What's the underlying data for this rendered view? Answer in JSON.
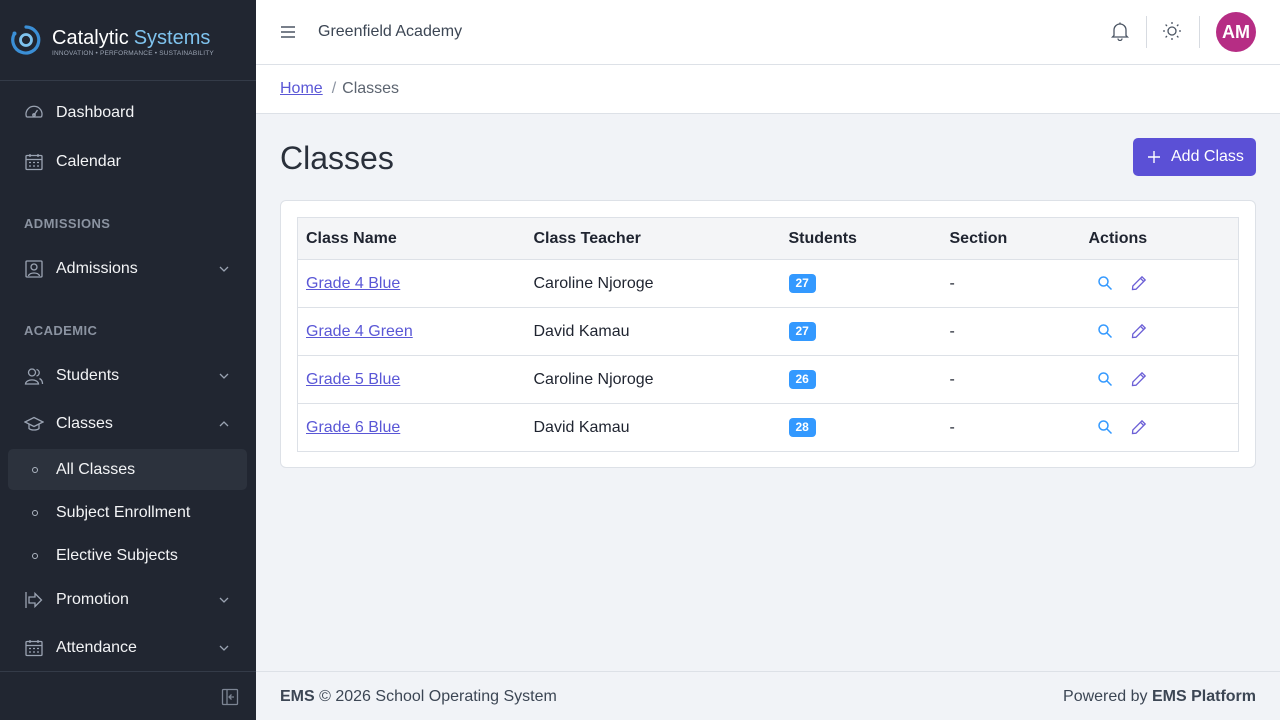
{
  "brand": {
    "name_primary": "Catalytic",
    "name_secondary": "Systems",
    "tagline": "INNOVATION • PERFORMANCE • SUSTAINABILITY",
    "accent_color": "#7fc3ee"
  },
  "sidebar": {
    "dashboard": "Dashboard",
    "calendar": "Calendar",
    "section_admissions": "ADMISSIONS",
    "admissions": "Admissions",
    "section_academic": "ACADEMIC",
    "students": "Students",
    "classes": "Classes",
    "classes_sub": [
      "All Classes",
      "Subject Enrollment",
      "Elective Subjects"
    ],
    "promotion": "Promotion",
    "attendance": "Attendance",
    "active_item": "All Classes"
  },
  "header": {
    "school_name": "Greenfield Academy",
    "avatar_initials": "AM",
    "avatar_color": "#b62d84"
  },
  "breadcrumb": {
    "home": "Home",
    "separator": "/",
    "current": "Classes"
  },
  "main": {
    "title": "Classes",
    "add_button": "Add Class",
    "table": {
      "headers": [
        "Class Name",
        "Class Teacher",
        "Students",
        "Section",
        "Actions"
      ],
      "rows": [
        {
          "name": "Grade 4 Blue",
          "teacher": "Caroline Njoroge",
          "students": "27",
          "section": "-"
        },
        {
          "name": "Grade 4 Green",
          "teacher": "David Kamau",
          "students": "27",
          "section": "-"
        },
        {
          "name": "Grade 5 Blue",
          "teacher": "Caroline Njoroge",
          "students": "26",
          "section": "-"
        },
        {
          "name": "Grade 6 Blue",
          "teacher": "David Kamau",
          "students": "28",
          "section": "-"
        }
      ]
    }
  },
  "footer": {
    "left_brand": "EMS",
    "left_text": "© 2026 School Operating System",
    "right_prefix": "Powered by",
    "right_brand": "EMS Platform"
  },
  "colors": {
    "sidebar_bg": "#212631",
    "primary": "#5b50d6",
    "badge": "#3399ff"
  }
}
